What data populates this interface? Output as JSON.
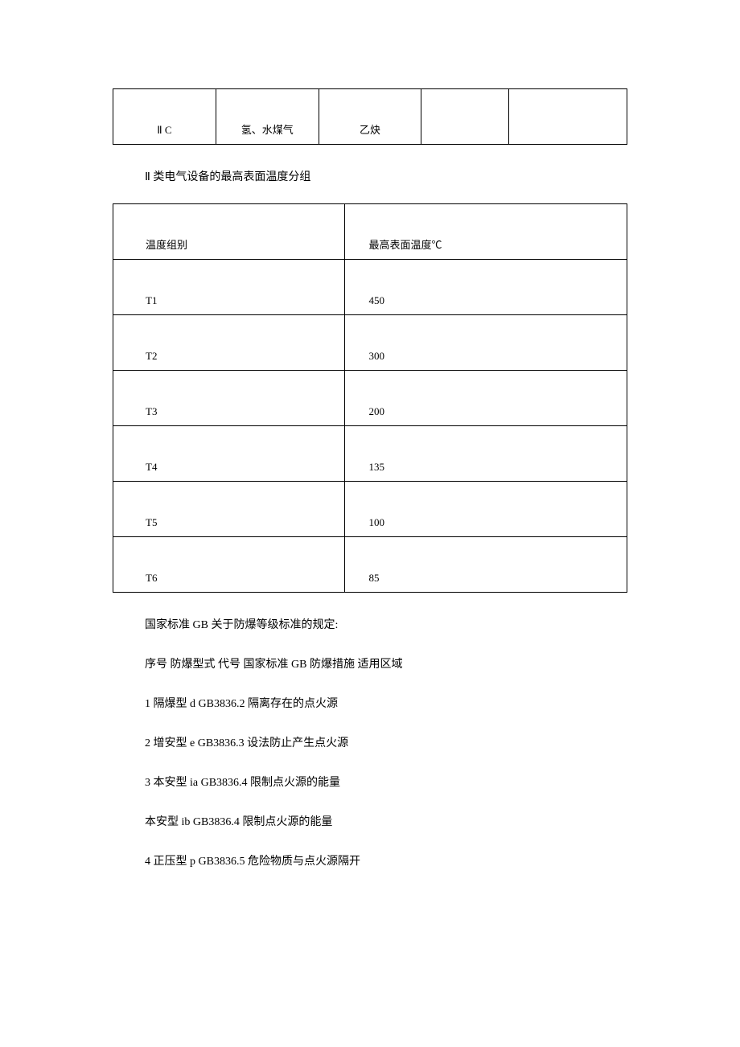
{
  "table1": {
    "row": [
      "Ⅱ C",
      "氢、水煤气",
      "乙炔",
      "",
      ""
    ]
  },
  "caption": "Ⅱ 类电气设备的最高表面温度分组",
  "table2": {
    "header": [
      "温度组别",
      "最高表面温度℃"
    ],
    "rows": [
      [
        "T1",
        "450"
      ],
      [
        "T2",
        "300"
      ],
      [
        "T3",
        "200"
      ],
      [
        "T4",
        "135"
      ],
      [
        "T5",
        "100"
      ],
      [
        "T6",
        "85"
      ]
    ]
  },
  "paragraphs": [
    "国家标准 GB 关于防爆等级标准的规定:",
    "序号 防爆型式 代号 国家标准 GB 防爆措施 适用区域",
    "1 隔爆型 d GB3836.2 隔离存在的点火源",
    "2 增安型 e GB3836.3 设法防止产生点火源",
    "3 本安型 ia GB3836.4 限制点火源的能量",
    "本安型 ib GB3836.4 限制点火源的能量",
    "4 正压型 p GB3836.5 危险物质与点火源隔开"
  ]
}
